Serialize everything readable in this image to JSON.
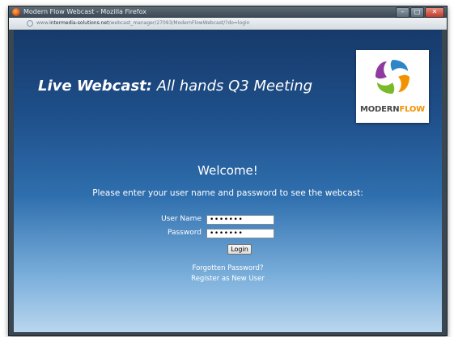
{
  "window": {
    "title": "Modern Flow Webcast - Mozilla Firefox",
    "buttons": {
      "minimize": "–",
      "maximize": "□",
      "close": "✕"
    }
  },
  "address_bar": {
    "prefix": "www.",
    "domain": "intermedia-solutions.net",
    "path": "/webcast_manager/27093/ModernFlowWebcast/?do=login"
  },
  "page": {
    "headline_bold": "Live Webcast:",
    "headline_rest": " All hands Q3 Meeting",
    "logo": {
      "part1": "MODERN",
      "part2": "FLOW",
      "accent_color": "#f39200"
    },
    "welcome": "Welcome!",
    "instructions": "Please enter your user name and password to see the webcast:",
    "form": {
      "username_label": "User Name",
      "username_value": "•••••••",
      "password_label": "Password",
      "password_value": "•••••••",
      "login_label": "Login"
    },
    "links": {
      "forgot_password": "Forgotten Password?",
      "register": "Register as New User"
    }
  }
}
